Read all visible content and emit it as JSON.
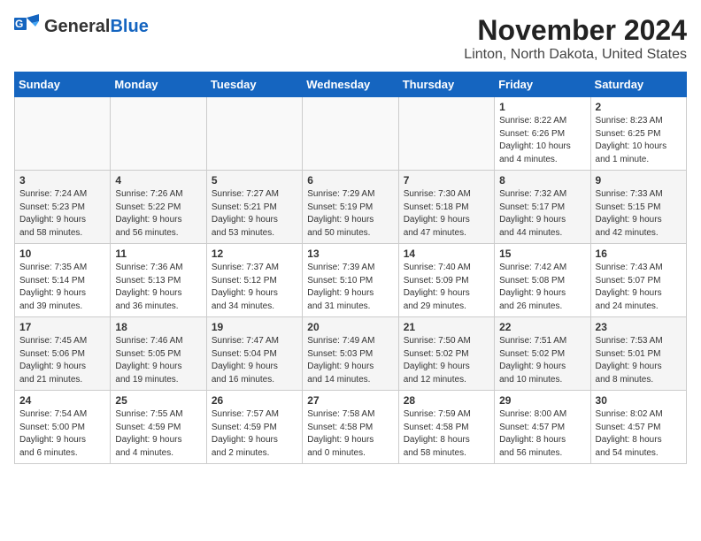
{
  "header": {
    "logo_general": "General",
    "logo_blue": "Blue",
    "title": "November 2024",
    "subtitle": "Linton, North Dakota, United States"
  },
  "weekdays": [
    "Sunday",
    "Monday",
    "Tuesday",
    "Wednesday",
    "Thursday",
    "Friday",
    "Saturday"
  ],
  "weeks": [
    [
      {
        "day": "",
        "info": ""
      },
      {
        "day": "",
        "info": ""
      },
      {
        "day": "",
        "info": ""
      },
      {
        "day": "",
        "info": ""
      },
      {
        "day": "",
        "info": ""
      },
      {
        "day": "1",
        "info": "Sunrise: 8:22 AM\nSunset: 6:26 PM\nDaylight: 10 hours\nand 4 minutes."
      },
      {
        "day": "2",
        "info": "Sunrise: 8:23 AM\nSunset: 6:25 PM\nDaylight: 10 hours\nand 1 minute."
      }
    ],
    [
      {
        "day": "3",
        "info": "Sunrise: 7:24 AM\nSunset: 5:23 PM\nDaylight: 9 hours\nand 58 minutes."
      },
      {
        "day": "4",
        "info": "Sunrise: 7:26 AM\nSunset: 5:22 PM\nDaylight: 9 hours\nand 56 minutes."
      },
      {
        "day": "5",
        "info": "Sunrise: 7:27 AM\nSunset: 5:21 PM\nDaylight: 9 hours\nand 53 minutes."
      },
      {
        "day": "6",
        "info": "Sunrise: 7:29 AM\nSunset: 5:19 PM\nDaylight: 9 hours\nand 50 minutes."
      },
      {
        "day": "7",
        "info": "Sunrise: 7:30 AM\nSunset: 5:18 PM\nDaylight: 9 hours\nand 47 minutes."
      },
      {
        "day": "8",
        "info": "Sunrise: 7:32 AM\nSunset: 5:17 PM\nDaylight: 9 hours\nand 44 minutes."
      },
      {
        "day": "9",
        "info": "Sunrise: 7:33 AM\nSunset: 5:15 PM\nDaylight: 9 hours\nand 42 minutes."
      }
    ],
    [
      {
        "day": "10",
        "info": "Sunrise: 7:35 AM\nSunset: 5:14 PM\nDaylight: 9 hours\nand 39 minutes."
      },
      {
        "day": "11",
        "info": "Sunrise: 7:36 AM\nSunset: 5:13 PM\nDaylight: 9 hours\nand 36 minutes."
      },
      {
        "day": "12",
        "info": "Sunrise: 7:37 AM\nSunset: 5:12 PM\nDaylight: 9 hours\nand 34 minutes."
      },
      {
        "day": "13",
        "info": "Sunrise: 7:39 AM\nSunset: 5:10 PM\nDaylight: 9 hours\nand 31 minutes."
      },
      {
        "day": "14",
        "info": "Sunrise: 7:40 AM\nSunset: 5:09 PM\nDaylight: 9 hours\nand 29 minutes."
      },
      {
        "day": "15",
        "info": "Sunrise: 7:42 AM\nSunset: 5:08 PM\nDaylight: 9 hours\nand 26 minutes."
      },
      {
        "day": "16",
        "info": "Sunrise: 7:43 AM\nSunset: 5:07 PM\nDaylight: 9 hours\nand 24 minutes."
      }
    ],
    [
      {
        "day": "17",
        "info": "Sunrise: 7:45 AM\nSunset: 5:06 PM\nDaylight: 9 hours\nand 21 minutes."
      },
      {
        "day": "18",
        "info": "Sunrise: 7:46 AM\nSunset: 5:05 PM\nDaylight: 9 hours\nand 19 minutes."
      },
      {
        "day": "19",
        "info": "Sunrise: 7:47 AM\nSunset: 5:04 PM\nDaylight: 9 hours\nand 16 minutes."
      },
      {
        "day": "20",
        "info": "Sunrise: 7:49 AM\nSunset: 5:03 PM\nDaylight: 9 hours\nand 14 minutes."
      },
      {
        "day": "21",
        "info": "Sunrise: 7:50 AM\nSunset: 5:02 PM\nDaylight: 9 hours\nand 12 minutes."
      },
      {
        "day": "22",
        "info": "Sunrise: 7:51 AM\nSunset: 5:02 PM\nDaylight: 9 hours\nand 10 minutes."
      },
      {
        "day": "23",
        "info": "Sunrise: 7:53 AM\nSunset: 5:01 PM\nDaylight: 9 hours\nand 8 minutes."
      }
    ],
    [
      {
        "day": "24",
        "info": "Sunrise: 7:54 AM\nSunset: 5:00 PM\nDaylight: 9 hours\nand 6 minutes."
      },
      {
        "day": "25",
        "info": "Sunrise: 7:55 AM\nSunset: 4:59 PM\nDaylight: 9 hours\nand 4 minutes."
      },
      {
        "day": "26",
        "info": "Sunrise: 7:57 AM\nSunset: 4:59 PM\nDaylight: 9 hours\nand 2 minutes."
      },
      {
        "day": "27",
        "info": "Sunrise: 7:58 AM\nSunset: 4:58 PM\nDaylight: 9 hours\nand 0 minutes."
      },
      {
        "day": "28",
        "info": "Sunrise: 7:59 AM\nSunset: 4:58 PM\nDaylight: 8 hours\nand 58 minutes."
      },
      {
        "day": "29",
        "info": "Sunrise: 8:00 AM\nSunset: 4:57 PM\nDaylight: 8 hours\nand 56 minutes."
      },
      {
        "day": "30",
        "info": "Sunrise: 8:02 AM\nSunset: 4:57 PM\nDaylight: 8 hours\nand 54 minutes."
      }
    ]
  ]
}
